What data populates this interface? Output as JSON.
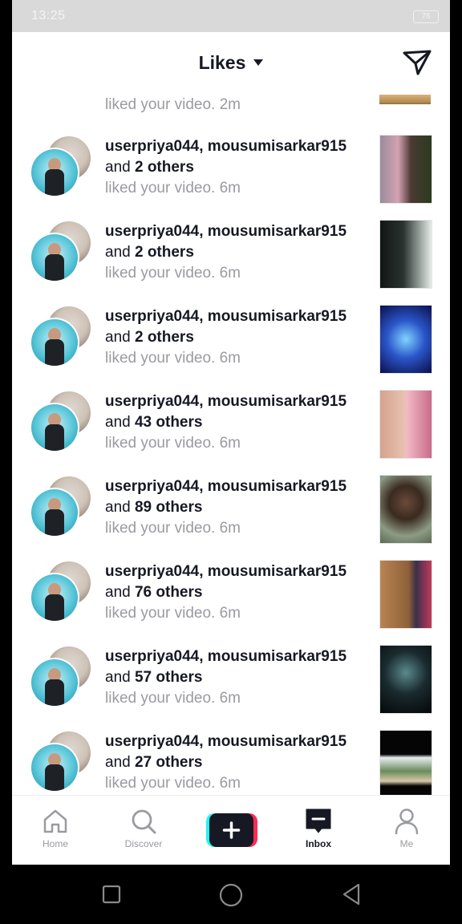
{
  "status_bar": {
    "time": "13:25",
    "battery": "76"
  },
  "header": {
    "title": "Likes"
  },
  "partial_row": {
    "text": "liked your video. 2m"
  },
  "rows": [
    {
      "users": "userpriya044, mousumisarkar915",
      "and_text": "and",
      "others": "2 others",
      "action": "liked your video. 6m"
    },
    {
      "users": "userpriya044, mousumisarkar915",
      "and_text": "and",
      "others": "2 others",
      "action": "liked your video. 6m"
    },
    {
      "users": "userpriya044, mousumisarkar915",
      "and_text": "and",
      "others": "2 others",
      "action": "liked your video. 6m"
    },
    {
      "users": "userpriya044, mousumisarkar915",
      "and_text": "and",
      "others": "43 others",
      "action": "liked your video. 6m"
    },
    {
      "users": "userpriya044, mousumisarkar915",
      "and_text": "and",
      "others": "89 others",
      "action": "liked your video. 6m"
    },
    {
      "users": "userpriya044, mousumisarkar915",
      "and_text": "and",
      "others": "76 others",
      "action": "liked your video. 6m"
    },
    {
      "users": "userpriya044, mousumisarkar915",
      "and_text": "and",
      "others": "57 others",
      "action": "liked your video. 6m"
    },
    {
      "users": "userpriya044, mousumisarkar915",
      "and_text": "and",
      "others": "27 others",
      "action": "liked your video. 6m"
    }
  ],
  "bottom_nav": {
    "home": "Home",
    "discover": "Discover",
    "inbox": "Inbox",
    "me": "Me"
  },
  "colors": {
    "accent_cyan": "#25f4ee",
    "accent_red": "#fe2c55",
    "text": "#161823",
    "muted": "#9a9ba0"
  }
}
